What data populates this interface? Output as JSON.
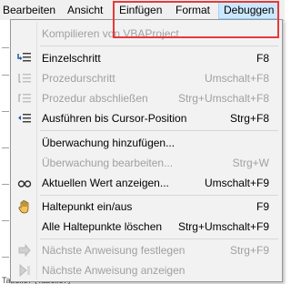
{
  "menubar": {
    "items": [
      "Bearbeiten",
      "Ansicht",
      "Einfügen",
      "Format",
      "Debuggen"
    ],
    "active": "Debuggen"
  },
  "menu": {
    "items": [
      {
        "label": "Kompilieren von VBAProject",
        "shortcut": "",
        "enabled": false,
        "icon": ""
      },
      {
        "label": "Einzelschritt",
        "shortcut": "F8",
        "enabled": true,
        "icon": "step-into-icon"
      },
      {
        "label": "Prozedurschritt",
        "shortcut": "Umschalt+F8",
        "enabled": false,
        "icon": "step-over-icon"
      },
      {
        "label": "Prozedur abschließen",
        "shortcut": "Strg+Umschalt+F8",
        "enabled": false,
        "icon": "step-out-icon"
      },
      {
        "label": "Ausführen bis Cursor-Position",
        "shortcut": "Strg+F8",
        "enabled": true,
        "icon": "run-to-cursor-icon"
      },
      {
        "label": "Überwachung hinzufügen...",
        "shortcut": "",
        "enabled": true,
        "icon": ""
      },
      {
        "label": "Überwachung bearbeiten...",
        "shortcut": "Strg+W",
        "enabled": false,
        "icon": ""
      },
      {
        "label": "Aktuellen Wert anzeigen...",
        "shortcut": "Umschalt+F9",
        "enabled": true,
        "icon": "quick-watch-icon"
      },
      {
        "label": "Haltepunkt ein/aus",
        "shortcut": "F9",
        "enabled": true,
        "icon": "hand-icon"
      },
      {
        "label": "Alle Haltepunkte löschen",
        "shortcut": "Strg+Umschalt+F9",
        "enabled": true,
        "icon": ""
      },
      {
        "label": "Nächste Anweisung festlegen",
        "shortcut": "Strg+F9",
        "enabled": false,
        "icon": "set-next-statement-icon"
      },
      {
        "label": "Nächste Anweisung anzeigen",
        "shortcut": "",
        "enabled": false,
        "icon": "show-next-statement-icon"
      }
    ]
  },
  "background": {
    "fragment": "Tabelle7 (Tabelle7)"
  },
  "colors": {
    "highlight_box": "#e8383b",
    "menu_bg": "#f2f2f2",
    "disabled_text": "#a0a0a0"
  }
}
